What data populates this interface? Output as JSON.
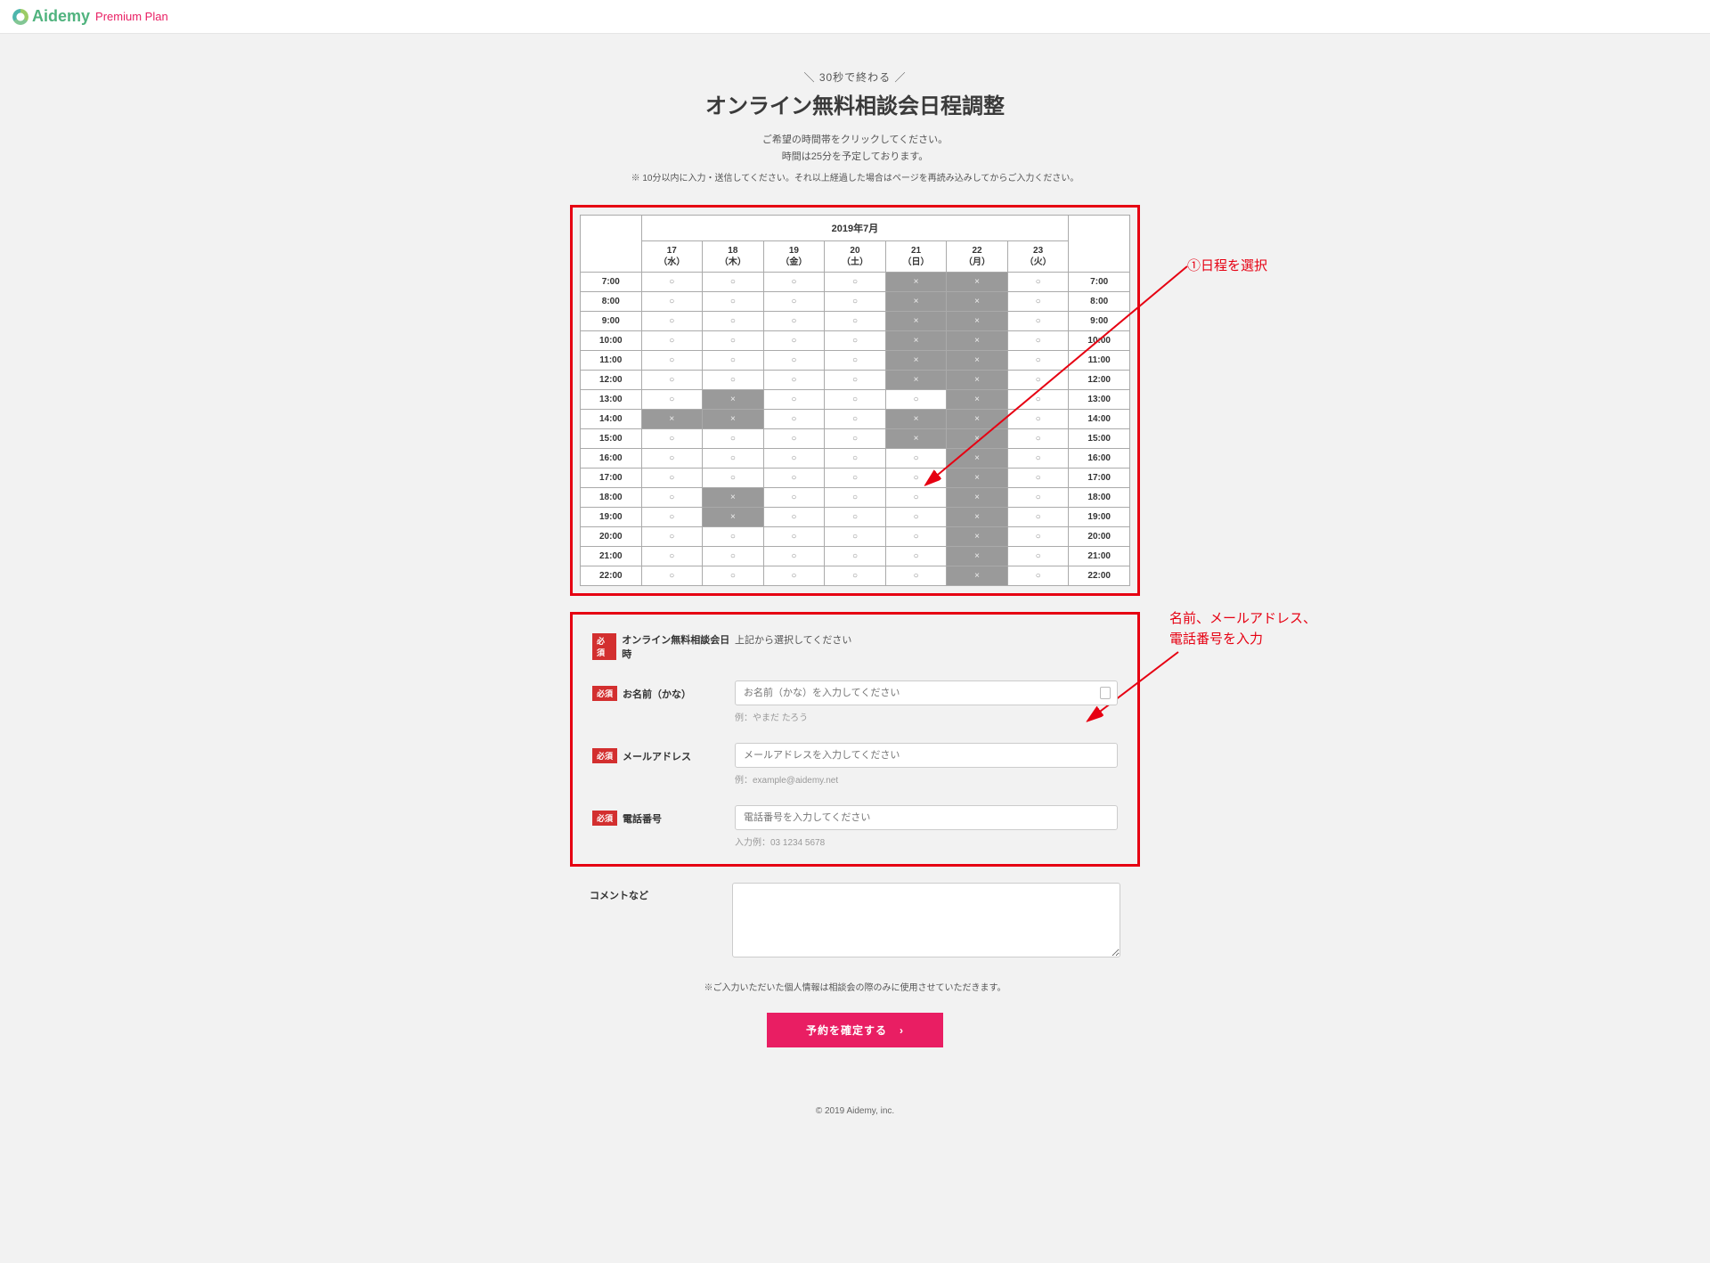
{
  "brand": {
    "name": "Aidemy",
    "plan": "Premium Plan"
  },
  "hero": {
    "tagline": "30秒で終わる",
    "title": "オンライン無料相談会日程調整",
    "desc_line1": "ご希望の時間帯をクリックしてください。",
    "desc_line2": "時間は25分を予定しております。",
    "desc_note": "※ 10分以内に入力・送信してください。それ以上経過した場合はページを再読み込みしてからご入力ください。"
  },
  "annot": {
    "step1": "①日程を選択",
    "step2_l1": "名前、メールアドレス、",
    "step2_l2": "電話番号を入力"
  },
  "calendar": {
    "month": "2019年7月",
    "days": [
      {
        "num": "17",
        "wd": "（水）",
        "cls": ""
      },
      {
        "num": "18",
        "wd": "（木）",
        "cls": ""
      },
      {
        "num": "19",
        "wd": "（金）",
        "cls": ""
      },
      {
        "num": "20",
        "wd": "（土）",
        "cls": "sat"
      },
      {
        "num": "21",
        "wd": "（日）",
        "cls": "sun"
      },
      {
        "num": "22",
        "wd": "（月）",
        "cls": ""
      },
      {
        "num": "23",
        "wd": "（火）",
        "cls": ""
      }
    ],
    "hours": [
      "7:00",
      "8:00",
      "9:00",
      "10:00",
      "11:00",
      "12:00",
      "13:00",
      "14:00",
      "15:00",
      "16:00",
      "17:00",
      "18:00",
      "19:00",
      "20:00",
      "21:00",
      "22:00"
    ],
    "slots": [
      [
        "o",
        "o",
        "o",
        "o",
        "x",
        "x",
        "o"
      ],
      [
        "o",
        "o",
        "o",
        "o",
        "x",
        "x",
        "o"
      ],
      [
        "o",
        "o",
        "o",
        "o",
        "x",
        "x",
        "o"
      ],
      [
        "o",
        "o",
        "o",
        "o",
        "x",
        "x",
        "o"
      ],
      [
        "o",
        "o",
        "o",
        "o",
        "x",
        "x",
        "o"
      ],
      [
        "o",
        "o",
        "o",
        "o",
        "x",
        "x",
        "o"
      ],
      [
        "o",
        "x",
        "o",
        "o",
        "o",
        "x",
        "o"
      ],
      [
        "x",
        "x",
        "o",
        "o",
        "x",
        "x",
        "o"
      ],
      [
        "o",
        "o",
        "o",
        "o",
        "x",
        "x",
        "o"
      ],
      [
        "o",
        "o",
        "o",
        "o",
        "o",
        "x",
        "o"
      ],
      [
        "o",
        "o",
        "o",
        "o",
        "o",
        "x",
        "o"
      ],
      [
        "o",
        "x",
        "o",
        "o",
        "o",
        "x",
        "o"
      ],
      [
        "o",
        "x",
        "o",
        "o",
        "o",
        "x",
        "o"
      ],
      [
        "o",
        "o",
        "o",
        "o",
        "o",
        "x",
        "o"
      ],
      [
        "o",
        "o",
        "o",
        "o",
        "o",
        "x",
        "o"
      ],
      [
        "o",
        "o",
        "o",
        "o",
        "o",
        "x",
        "o"
      ]
    ]
  },
  "form": {
    "required_badge": "必須",
    "datetime": {
      "label": "オンライン無料相談会日時",
      "value": "上記から選択してください"
    },
    "name": {
      "label": "お名前（かな）",
      "placeholder": "お名前（かな）を入力してください",
      "hint": "例：やまだ たろう"
    },
    "email": {
      "label": "メールアドレス",
      "placeholder": "メールアドレスを入力してください",
      "hint": "例：example@aidemy.net"
    },
    "phone": {
      "label": "電話番号",
      "placeholder": "電話番号を入力してください",
      "hint": "入力例：03 1234 5678"
    },
    "comment": {
      "label": "コメントなど"
    }
  },
  "privacy_note": "※ご入力いただいた個人情報は相談会の際のみに使用させていただきます。",
  "submit_label": "予約を確定する",
  "footer": "© 2019 Aidemy, inc."
}
